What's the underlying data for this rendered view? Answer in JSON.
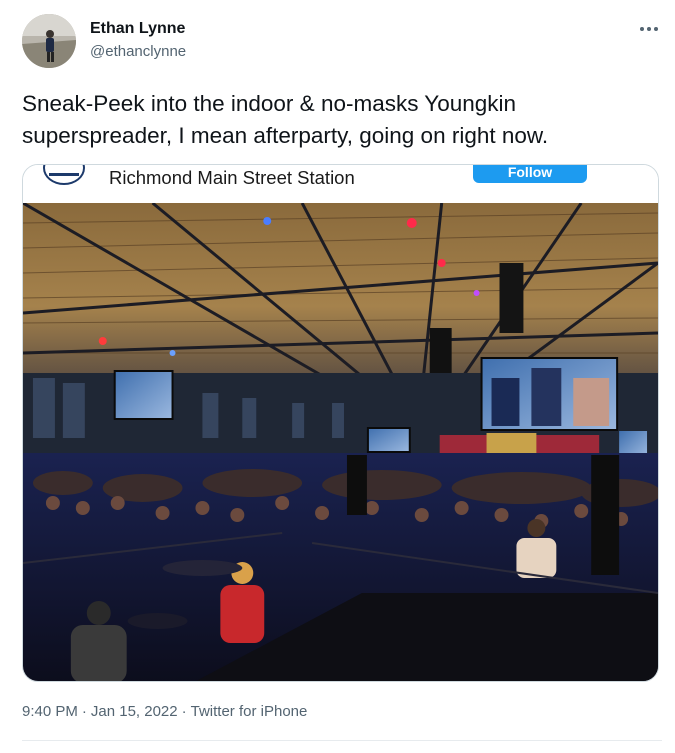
{
  "author": {
    "display_name": "Ethan Lynne",
    "handle": "@ethanclynne"
  },
  "tweet": {
    "text": "Sneak-Peek into the indoor & no-masks Youngkin superspreader, I mean afterparty, going on right now."
  },
  "embed": {
    "title": "Richmond Main Street Station",
    "follow_label": "Follow"
  },
  "meta": {
    "time": "9:40 PM",
    "separator": "·",
    "date": "Jan 15, 2022",
    "source": "Twitter for iPhone"
  },
  "colors": {
    "accent": "#1d9bf0",
    "text": "#0f1419",
    "secondary": "#536471",
    "border": "#cfd9de"
  },
  "icons": {
    "more": "more-dots-icon"
  }
}
